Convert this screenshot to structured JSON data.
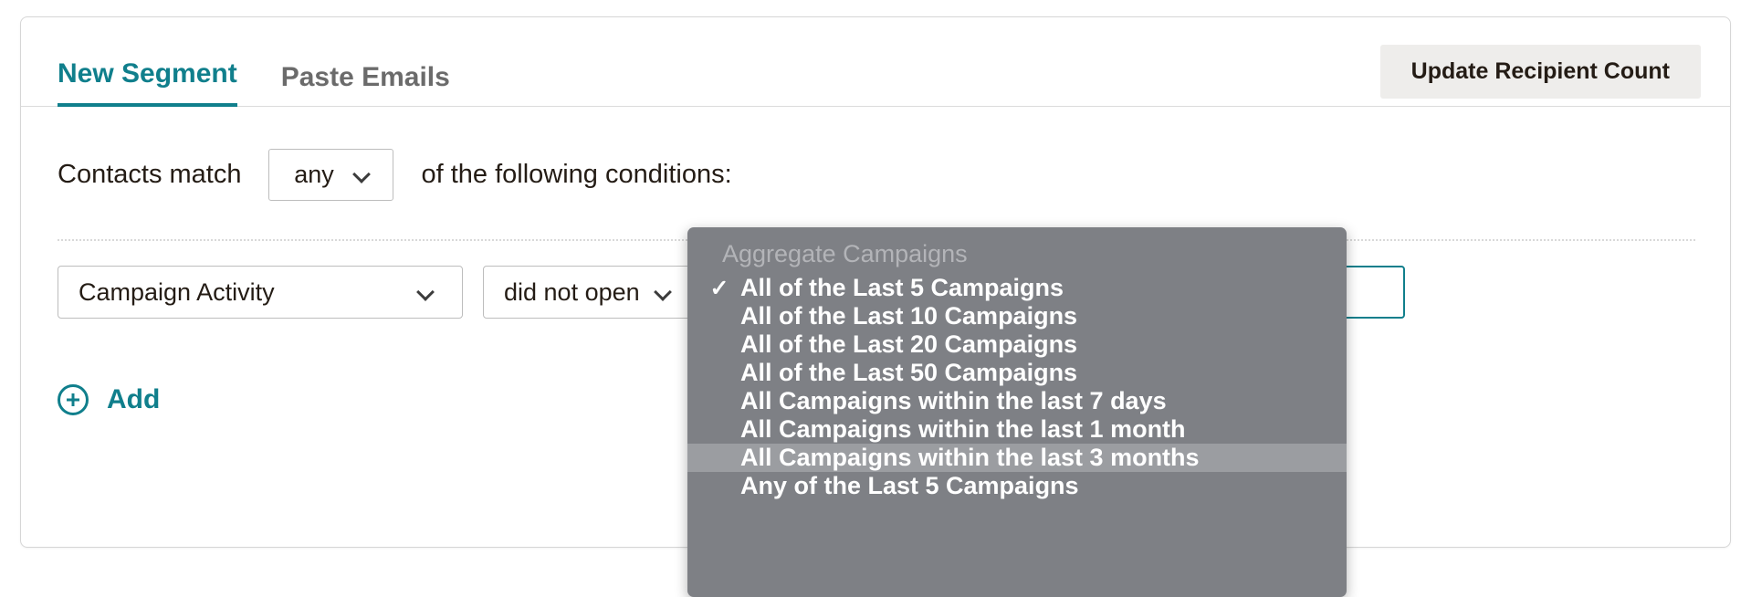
{
  "tabs": [
    {
      "label": "New Segment",
      "active": true
    },
    {
      "label": "Paste Emails",
      "active": false
    }
  ],
  "toolbar": {
    "update_label": "Update Recipient Count"
  },
  "match": {
    "prefix": "Contacts match",
    "operator": "any",
    "suffix": "of the following conditions:"
  },
  "condition": {
    "field": "Campaign Activity",
    "operator": "did not open",
    "value": ""
  },
  "add": {
    "label": "Add",
    "icon": "plus-circle-icon"
  },
  "dropdown": {
    "header": "Aggregate Campaigns",
    "checked_index": 0,
    "highlight_index": 6,
    "items": [
      "All of the Last 5 Campaigns",
      "All of the Last 10 Campaigns",
      "All of the Last 20 Campaigns",
      "All of the Last 50 Campaigns",
      "All Campaigns within the last 7 days",
      "All Campaigns within the last 1 month",
      "All Campaigns within the last 3 months",
      "Any of the Last 5 Campaigns"
    ],
    "check_glyph": "✓"
  },
  "colors": {
    "accent_teal": "#107f8c",
    "dropdown_bg": "#7e8085",
    "dropdown_highlight": "#9b9da1",
    "button_bg": "#eeedeb"
  }
}
